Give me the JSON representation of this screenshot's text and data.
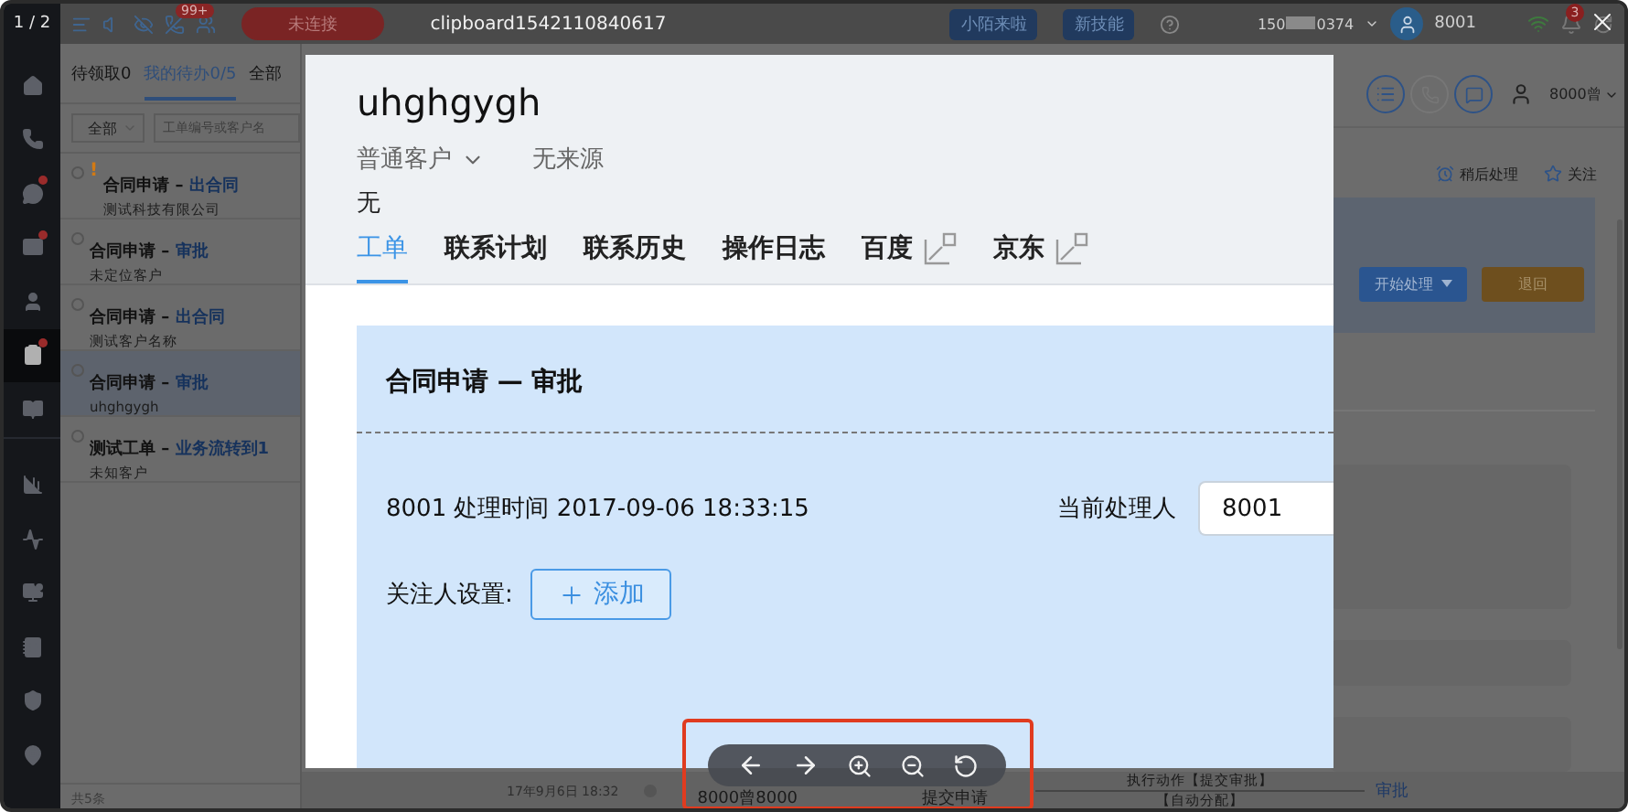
{
  "viewer": {
    "counter": "1 / 2",
    "title": "clipboard1542110840617"
  },
  "topbar": {
    "badge_count": "99+",
    "status_button": "未连接",
    "promo_tags": [
      "小陌来啦",
      "新技能"
    ],
    "phone_prefix": "150",
    "phone_suffix": "0374",
    "user": "8001",
    "bell_count": "3"
  },
  "sidebar": [
    {
      "kind": "home",
      "badge": false,
      "selected": false
    },
    {
      "kind": "phone",
      "badge": false,
      "selected": false
    },
    {
      "kind": "chat",
      "badge": true,
      "selected": false
    },
    {
      "kind": "mail",
      "badge": true,
      "selected": false
    },
    {
      "kind": "user",
      "badge": false,
      "selected": false
    },
    {
      "kind": "tasks",
      "badge": true,
      "selected": true
    },
    {
      "kind": "book",
      "badge": false,
      "selected": false
    },
    {
      "kind": "chart",
      "badge": false,
      "selected": false
    },
    {
      "kind": "pulse",
      "badge": false,
      "selected": false
    },
    {
      "kind": "monitor",
      "badge": false,
      "selected": false
    },
    {
      "kind": "notes",
      "badge": false,
      "selected": false
    },
    {
      "kind": "shield",
      "badge": false,
      "selected": false
    },
    {
      "kind": "pin",
      "badge": false,
      "selected": false
    }
  ],
  "list": {
    "tabs": [
      {
        "label": "待领取0",
        "selected": false
      },
      {
        "label": "我的待办0/5",
        "selected": true
      },
      {
        "label": "全部",
        "selected": false
      }
    ],
    "filter": "全部",
    "search_placeholder": "工单编号或客户名",
    "items": [
      {
        "flag": "!",
        "title": "合同申请 –",
        "action": "出合同",
        "customer": "测试科技有限公司",
        "selected": false
      },
      {
        "title": "合同申请 –",
        "action": "审批",
        "customer": "未定位客户",
        "selected": false
      },
      {
        "title": "合同申请 –",
        "action": "出合同",
        "customer": "测试客户名称",
        "selected": false
      },
      {
        "title": "合同申请 –",
        "action": "审批",
        "customer": "uhghgygh",
        "selected": true
      },
      {
        "title": "测试工单 –",
        "action": "业务流转到1",
        "customer": "未知客户",
        "selected": false
      }
    ],
    "footer": "共5条"
  },
  "detail": {
    "agent": "8000曾",
    "actions": [
      "稍后处理",
      "关注"
    ],
    "buttons": [
      {
        "label": "开始处理",
        "kind": "dropdown"
      },
      {
        "label": "退回",
        "kind": "warning"
      }
    ]
  },
  "timeline": {
    "time": "17年9月6日 18:32",
    "operator": "8000曾8000",
    "step": "提交申请",
    "action": "执行动作【提交审批】",
    "sub_action": "【自动分配】",
    "target": "审批"
  },
  "image": {
    "customer_name": "uhghgygh",
    "customer_type": "普通客户",
    "source": "无来源",
    "note": "无",
    "tabs": [
      {
        "label": "工单",
        "selected": true,
        "external": false
      },
      {
        "label": "联系计划",
        "selected": false,
        "external": false
      },
      {
        "label": "联系历史",
        "selected": false,
        "external": false
      },
      {
        "label": "操作日志",
        "selected": false,
        "external": false
      },
      {
        "label": "百度",
        "selected": false,
        "external": true
      },
      {
        "label": "京东",
        "selected": false,
        "external": true
      }
    ],
    "card": {
      "title": "合同申请 — 审批",
      "handler_line": "8001 处理时间 2017-09-06 18:33:15",
      "handler_label": "当前处理人",
      "handler_value": "8001",
      "follower_label": "关注人设置:",
      "add_button": "添加"
    }
  }
}
